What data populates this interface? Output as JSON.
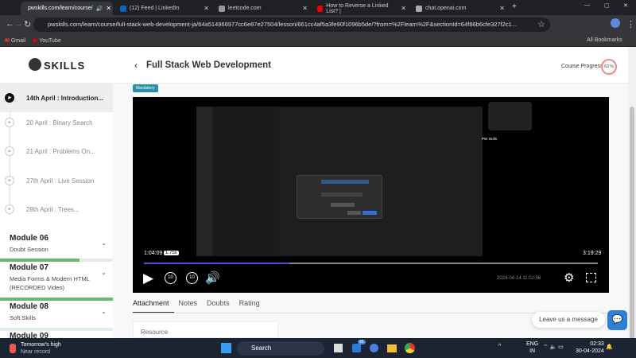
{
  "browser": {
    "tabs": [
      {
        "title": "pwskills.com/learn/course/",
        "active": true,
        "color": "#888"
      },
      {
        "title": "(12) Feed | LinkedIn",
        "active": false,
        "color": "#0a66c2"
      },
      {
        "title": "leetcode.com",
        "active": false,
        "color": "#999"
      },
      {
        "title": "How to Reverse a Linked List? |",
        "active": false,
        "color": "#e00"
      },
      {
        "title": "chat.openai.com",
        "active": false,
        "color": "#aaa"
      }
    ],
    "url": "pwskills.com/learn/course/full-stack-web-development-ja/64a514966977cc6e87e27504/lesson/661cc4af5a3fe90f1096b5de/?from=%2Flearn%2F&sectionId=64f86b6cfe327f2c1...",
    "bookmarks": [
      "Gmail",
      "YouTube"
    ],
    "all_bookmarks": "All Bookmarks"
  },
  "header": {
    "logo": "SKILLS",
    "title": "Full Stack Web Development",
    "progress_label": "Course Progress",
    "progress_value": "63 %",
    "progress_pct": 63
  },
  "sidebar": {
    "lessons": [
      "14th April : Introduction...",
      "20 April : Binary Search",
      "21 April : Problems On...",
      "27th April : Live Session",
      "28th April : Trees..."
    ],
    "modules": [
      {
        "title": "Module 06",
        "subtitle": "Doubt Session",
        "progress": 70
      },
      {
        "title": "Module 07",
        "subtitle": "Media Forms & Modern HTML (RECORDED Video)",
        "progress": 100
      },
      {
        "title": "Module 08",
        "subtitle": "Soft Skills",
        "progress": 0
      },
      {
        "title": "Module 09",
        "subtitle": "",
        "progress": 0
      }
    ]
  },
  "badge": "Mandatory",
  "video": {
    "current": "1:04:09",
    "speed": "1.75x",
    "duration": "3:19:29",
    "played_pct": 32,
    "timestamp": "2024-04-14 11:02:56",
    "presenter": "PW Skills",
    "skip": "10"
  },
  "content_tabs": [
    "Attachment",
    "Notes",
    "Doubts",
    "Rating"
  ],
  "resource_label": "Resource",
  "chat": {
    "label": "Leave us a message"
  },
  "taskbar": {
    "weather_title": "Tomorrow's high",
    "weather_sub": "Near record",
    "search": "Search",
    "lang1": "ENG",
    "lang2": "IN",
    "time": "02:33",
    "date": "30-04-2024",
    "badge": "45"
  }
}
